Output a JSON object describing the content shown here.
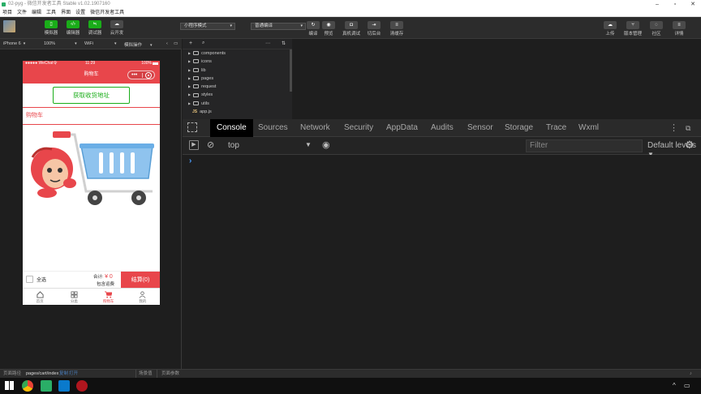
{
  "window": {
    "title": "02-pyg - 微信开发者工具 Stable v1.02.1907160"
  },
  "menu": [
    "项目",
    "文件",
    "编辑",
    "工具",
    "界面",
    "设置",
    "微信开发者工具"
  ],
  "toolbar": {
    "left_buttons": [
      {
        "label": "模拟器",
        "icon": "phone-icon"
      },
      {
        "label": "编辑器",
        "icon": "code-icon"
      },
      {
        "label": "调试器",
        "icon": "debug-icon"
      },
      {
        "label": "云开发",
        "icon": "cloud-icon"
      }
    ],
    "mode_select": "小程序模式",
    "compile_select": "普通编译",
    "mid_buttons": [
      "编译",
      "预览",
      "真机调试",
      "切后台",
      "清缓存"
    ],
    "right_buttons": [
      "上传",
      "版本管理",
      "社区",
      "详情"
    ]
  },
  "simbar": {
    "device": "iPhone 6",
    "zoom": "100%",
    "network": "WiFi",
    "hot_action": "模拟操作"
  },
  "phone": {
    "status_left": "●●●●● WeChat令",
    "status_time": "11:29",
    "status_right": "100%",
    "nav_title": "购物车",
    "address_button": "获取收货地址",
    "cart_title": "购物车",
    "select_all": "全选",
    "total_label": "合计:",
    "total_amount": "¥ 0",
    "shipping": "包含运费",
    "settle_button": "结算(0)",
    "tabs": [
      {
        "label": "首页",
        "icon": "home-icon"
      },
      {
        "label": "分类",
        "icon": "grid-icon"
      },
      {
        "label": "购物车",
        "icon": "cart-icon",
        "active": true
      },
      {
        "label": "我的",
        "icon": "user-icon"
      }
    ],
    "accent": "#e8464b"
  },
  "filetree": {
    "items": [
      {
        "name": "components",
        "type": "folder"
      },
      {
        "name": "icons",
        "type": "folder"
      },
      {
        "name": "lib",
        "type": "folder"
      },
      {
        "name": "pages",
        "type": "folder"
      },
      {
        "name": "request",
        "type": "folder"
      },
      {
        "name": "styles",
        "type": "folder"
      },
      {
        "name": "utils",
        "type": "folder"
      },
      {
        "name": "app.js",
        "type": "js"
      }
    ]
  },
  "devtools": {
    "tabs": [
      "Console",
      "Sources",
      "Network",
      "Security",
      "AppData",
      "Audits",
      "Sensor",
      "Storage",
      "Trace",
      "Wxml"
    ],
    "active_tab": "Console",
    "context": "top",
    "filter_placeholder": "Filter",
    "levels": "Default levels",
    "prompt": "›"
  },
  "statusbar": {
    "path_label": "页面路径",
    "path_value": "pages/cart/index",
    "copy": "复制",
    "open": "打开",
    "scene": "场景值",
    "params": "页面参数"
  }
}
